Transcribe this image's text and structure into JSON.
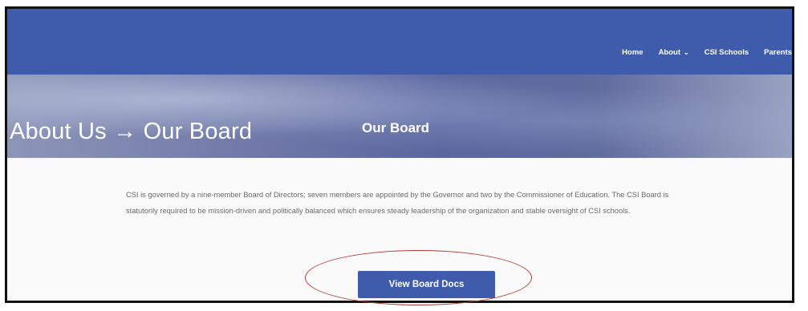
{
  "nav": {
    "items": [
      {
        "label": "Home"
      },
      {
        "label": "About",
        "has_dropdown": true
      },
      {
        "label": "CSI Schools"
      },
      {
        "label": "Parents"
      }
    ]
  },
  "hero": {
    "title": "Our Board"
  },
  "annotation": {
    "caption": "About Us → Our Board",
    "circle_color": "#b23a35"
  },
  "content": {
    "paragraph": "CSI is governed by a nine-member Board of Directors; seven members are appointed by the Governor and two by the Commissioner of Education. The CSI Board is statutorily required to be mission-driven and politically balanced which ensures steady leadership of the organization and stable oversight of CSI schools."
  },
  "cta": {
    "label": "View Board Docs"
  },
  "colors": {
    "brand_blue": "#3f5bab"
  }
}
